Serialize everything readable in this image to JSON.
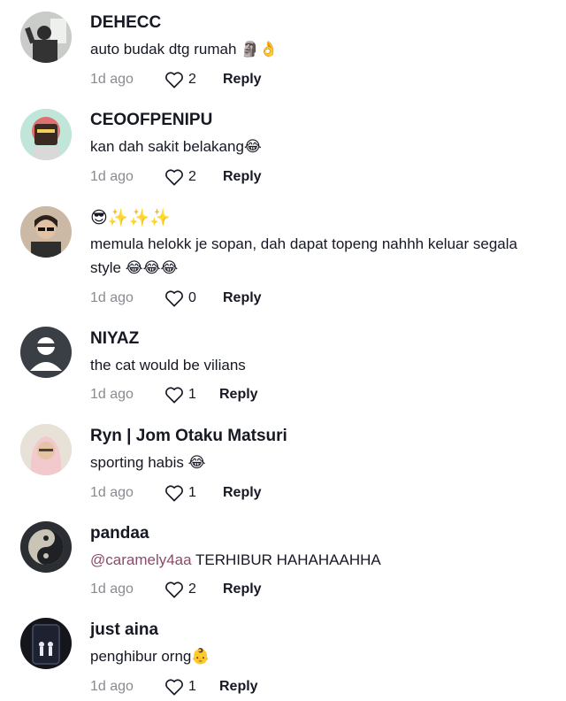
{
  "comments": [
    {
      "username": "DEHECC",
      "text": "auto budak dtg rumah",
      "emoji": "🗿👌",
      "time": "1d ago",
      "likes": "2",
      "reply": "Reply"
    },
    {
      "username": "CEOOFPENIPU",
      "text": "kan dah sakit belakang",
      "emoji": "😂",
      "time": "1d ago",
      "likes": "2",
      "reply": "Reply"
    },
    {
      "username": "😎✨✨✨",
      "text": "memula helokk je sopan, dah dapat topeng nahhh keluar segala style",
      "emoji": "😂😂😂",
      "time": "1d ago",
      "likes": "0",
      "reply": "Reply"
    },
    {
      "username": "NIYAZ",
      "text": "the cat would be vilians",
      "emoji": "",
      "time": "1d ago",
      "likes": "1",
      "reply": "Reply"
    },
    {
      "username": "Ryn | Jom Otaku Matsuri",
      "text": "sporting habis",
      "emoji": "😂",
      "time": "1d ago",
      "likes": "1",
      "reply": "Reply"
    },
    {
      "username": "pandaa",
      "mention": "@caramely4aa",
      "text": "TERHIBUR HAHAHAAHHA",
      "emoji": "",
      "time": "1d ago",
      "likes": "2",
      "reply": "Reply"
    },
    {
      "username": "just aina",
      "text": "penghibur orng",
      "emoji": "👶",
      "time": "1d ago",
      "likes": "1",
      "reply": "Reply"
    }
  ],
  "colors": {
    "text": "#161823",
    "muted": "#8a8b91",
    "mention": "#8b4a6a"
  },
  "icons": {
    "like": "heart-outline-icon"
  }
}
